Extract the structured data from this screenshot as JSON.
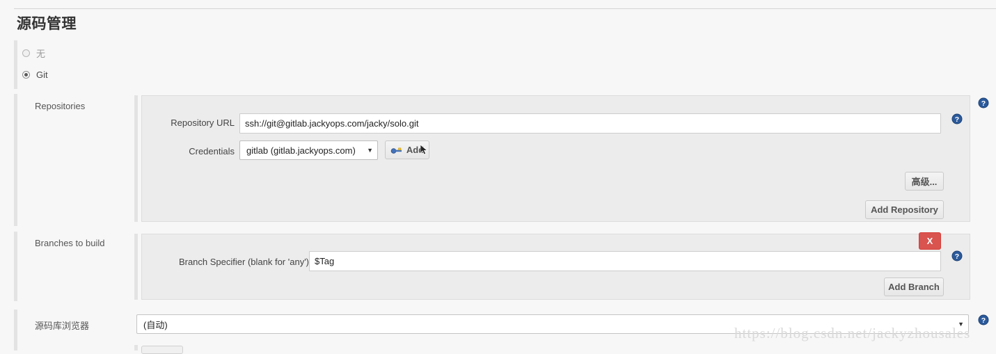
{
  "page": {
    "title": "源码管理",
    "watermark": "https://blog.csdn.net/jackyzhousales"
  },
  "scm_options": [
    {
      "label": "无",
      "selected": false
    },
    {
      "label": "Git",
      "selected": true
    }
  ],
  "repositories": {
    "section_label": "Repositories",
    "url_label": "Repository URL",
    "url_value": "ssh://git@gitlab.jackyops.com/jacky/solo.git",
    "credentials_label": "Credentials",
    "credentials_value": "gitlab (gitlab.jackyops.com)",
    "add_credentials_label": "Add",
    "advanced_label": "高级...",
    "add_repository_label": "Add Repository"
  },
  "branches": {
    "section_label": "Branches to build",
    "specifier_label": "Branch Specifier (blank for 'any')",
    "specifier_value": "$Tag",
    "delete_label": "X",
    "add_branch_label": "Add Branch"
  },
  "repo_browser": {
    "label": "源码库浏览器",
    "value": "(自动)"
  },
  "icons": {
    "help": "help-icon",
    "key": "key-icon",
    "caret": "▼"
  },
  "colors": {
    "accent_blue": "#2b5a9b",
    "danger_red": "#d9534f",
    "panel_bg": "#ececec",
    "page_bg": "#f7f7f7"
  }
}
